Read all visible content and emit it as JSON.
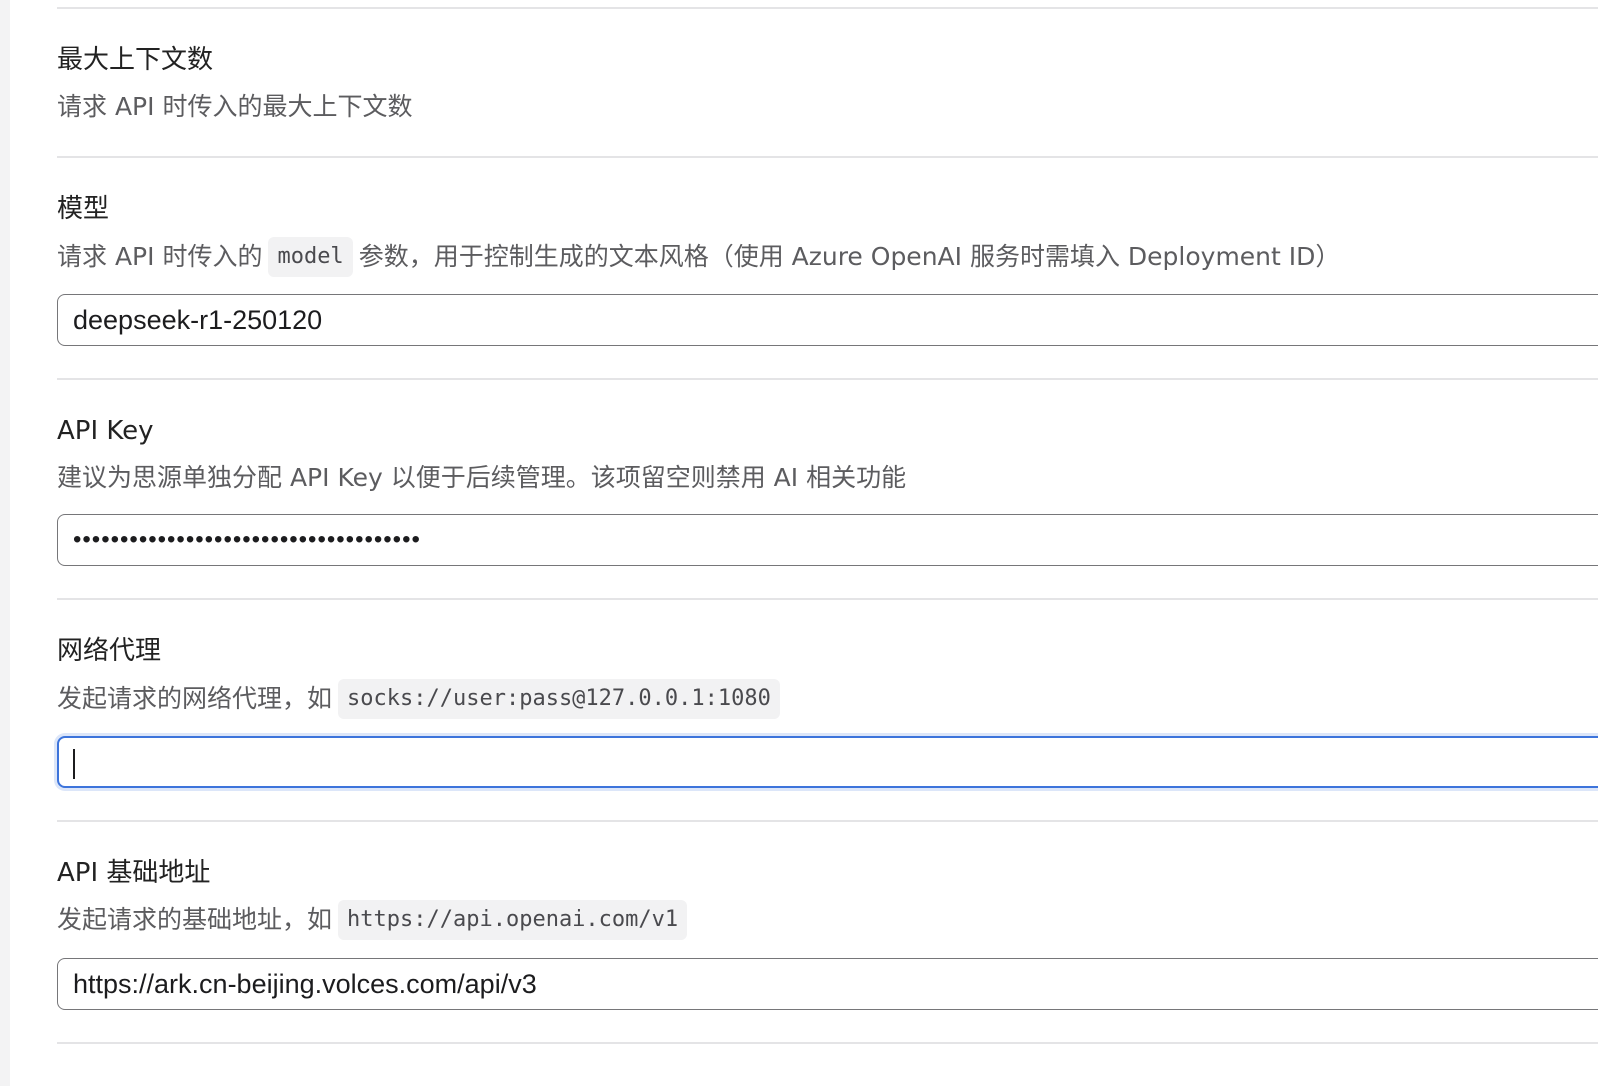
{
  "sections": {
    "max_context": {
      "title": "最大上下文数",
      "description": "请求 API 时传入的最大上下文数"
    },
    "model": {
      "title": "模型",
      "description_before": "请求 API 时传入的",
      "description_code": "model",
      "description_after": "参数，用于控制生成的文本风格（使用 Azure OpenAI 服务时需填入 Deployment ID）",
      "value": "deepseek-r1-250120"
    },
    "api_key": {
      "title": "API Key",
      "description": "建议为思源单独分配 API Key 以便于后续管理。该项留空则禁用 AI 相关功能",
      "masked_value": "•••••••••••••••••••••••••••••••••••••"
    },
    "proxy": {
      "title": "网络代理",
      "description_before": "发起请求的网络代理，如",
      "description_code": "socks://user:pass@127.0.0.1:1080",
      "value": ""
    },
    "base_url": {
      "title": "API 基础地址",
      "description_before": "发起请求的基础地址，如",
      "description_code": "https://api.openai.com/v1",
      "value": "https://ark.cn-beijing.volces.com/api/v3"
    }
  }
}
